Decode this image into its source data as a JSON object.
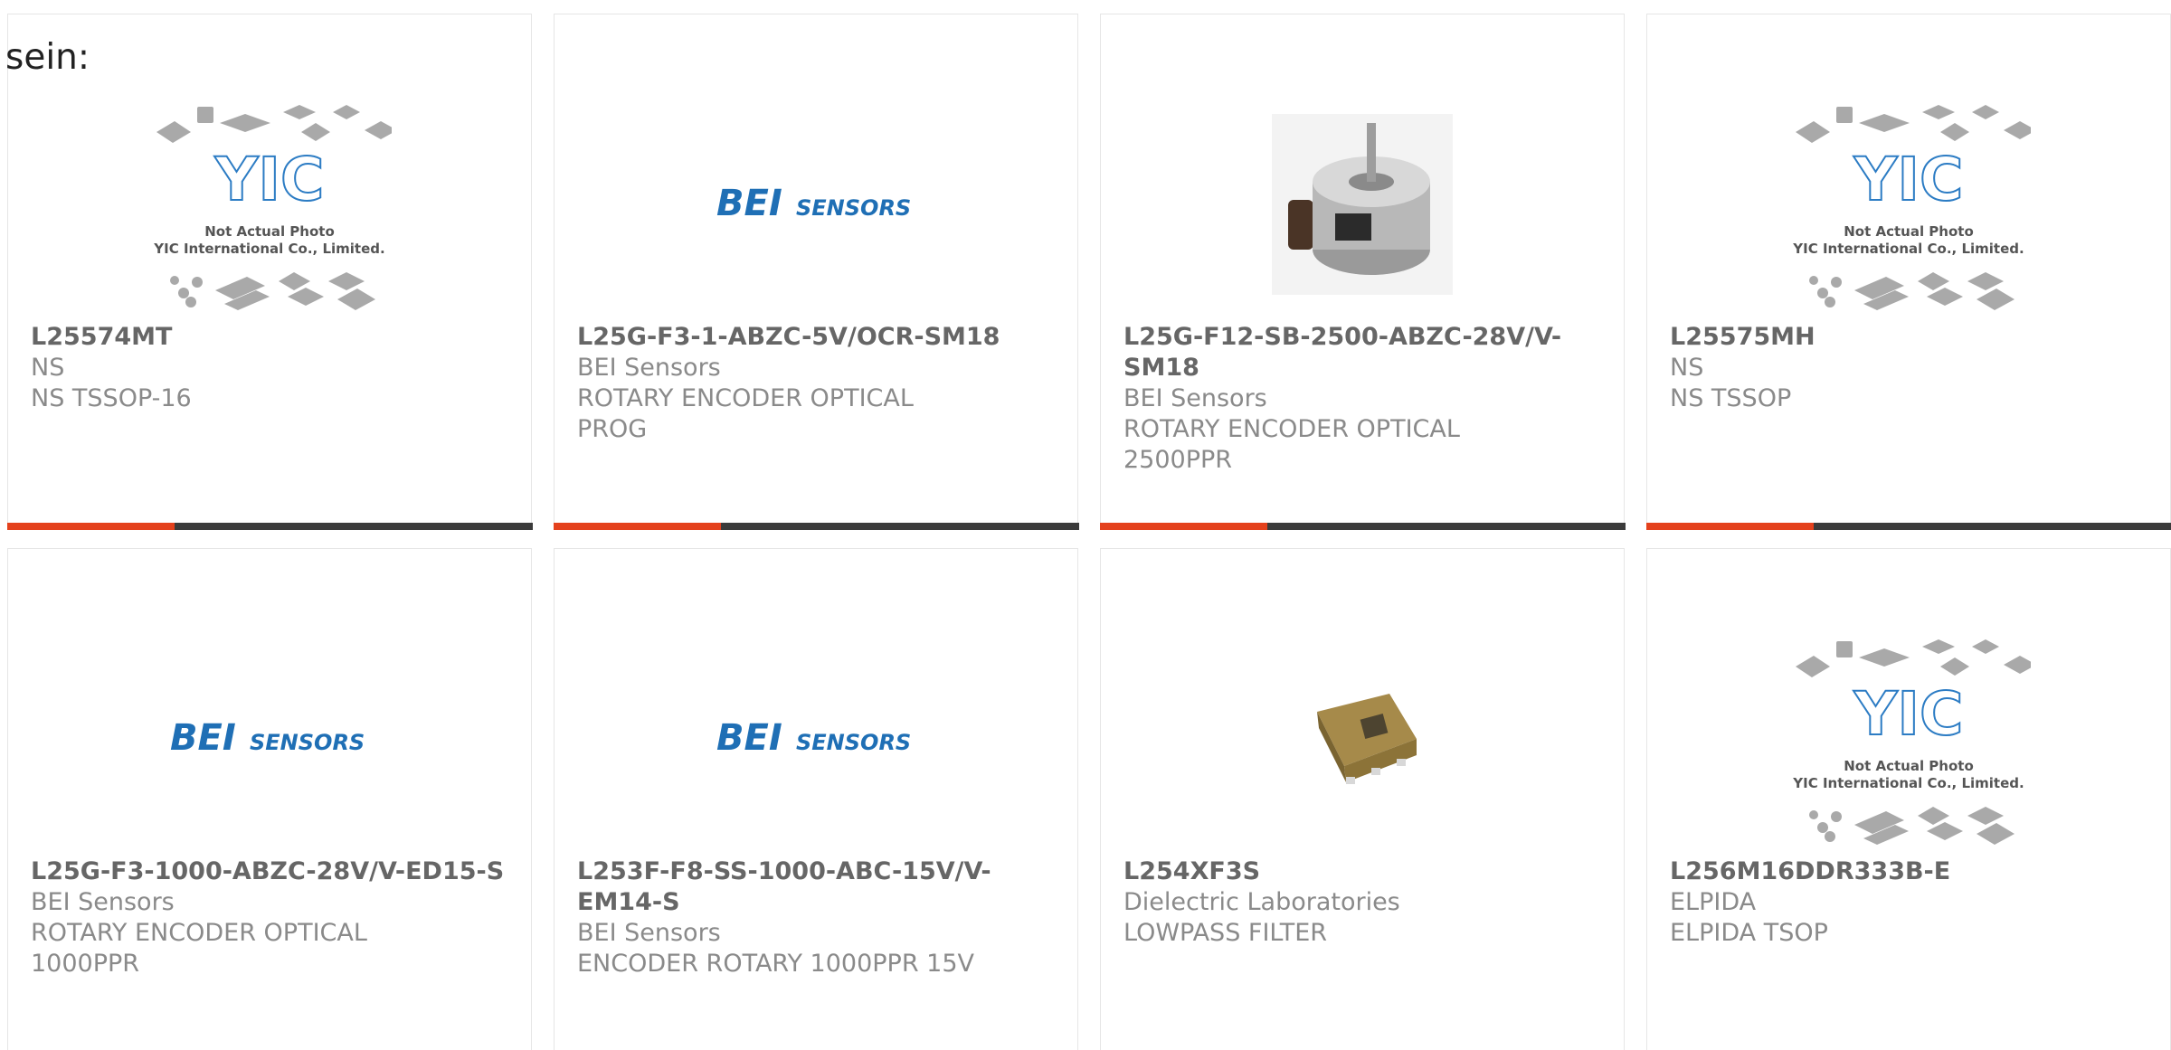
{
  "fragment_text": "sein:",
  "placeholder": {
    "caption_line1": "Not Actual Photo",
    "caption_line2": "YIC International Co., Limited.",
    "logo_text": "YIC"
  },
  "bei_logo": {
    "bold": "BEI",
    "rest": "SENSORS"
  },
  "colors": {
    "accent": "#e4411d",
    "bar_track": "#3b3b3b",
    "bei_blue": "#1f6fb5",
    "yic_blue": "#2c7cc4"
  },
  "cards": [
    {
      "part": "L25574MT",
      "brand": "NS",
      "desc1": "NS TSSOP-16",
      "desc2": "",
      "image": "placeholder-icon",
      "progress": 0.32
    },
    {
      "part": "L25G-F3-1-ABZC-5V/OCR-SM18",
      "brand": "BEI Sensors",
      "desc1": "ROTARY ENCODER OPTICAL",
      "desc2": "PROG",
      "image": "bei-logo",
      "progress": 0.32
    },
    {
      "part": "L25G-F12-SB-2500-ABZC-28V/V-SM18",
      "brand": "BEI Sensors",
      "desc1": "ROTARY ENCODER OPTICAL",
      "desc2": "2500PPR",
      "image": "encoder-photo",
      "progress": 0.32
    },
    {
      "part": "L25575MH",
      "brand": "NS",
      "desc1": "NS TSSOP",
      "desc2": "",
      "image": "placeholder-icon",
      "progress": 0.32
    },
    {
      "part": "L25G-F3-1000-ABZC-28V/V-ED15-S",
      "brand": "BEI Sensors",
      "desc1": "ROTARY ENCODER OPTICAL",
      "desc2": "1000PPR",
      "image": "bei-logo",
      "progress": 0.0
    },
    {
      "part": "L253F-F8-SS-1000-ABC-15V/V-EM14-S",
      "brand": "BEI Sensors",
      "desc1": "ENCODER ROTARY 1000PPR 15V",
      "desc2": "",
      "image": "bei-logo",
      "progress": 0.0
    },
    {
      "part": "L254XF3S",
      "brand": "Dielectric Laboratories",
      "desc1": "LOWPASS FILTER",
      "desc2": "",
      "image": "filter-photo",
      "progress": 0.0
    },
    {
      "part": "L256M16DDR333B-E",
      "brand": "ELPIDA",
      "desc1": "ELPIDA TSOP",
      "desc2": "",
      "image": "placeholder-icon",
      "progress": 0.0
    }
  ]
}
